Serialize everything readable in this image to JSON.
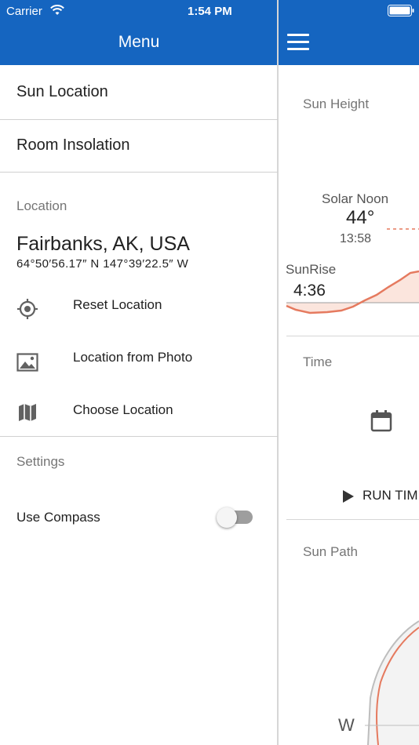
{
  "status_bar": {
    "carrier": "Carrier",
    "time": "1:54 PM"
  },
  "drawer": {
    "title": "Menu",
    "items": [
      {
        "label": "Sun Location"
      },
      {
        "label": "Room Insolation"
      }
    ],
    "location_section": {
      "header": "Location",
      "place": "Fairbanks, AK, USA",
      "coordinates": "64°50′56.17″ N 147°39′22.5″ W",
      "actions": [
        {
          "label": "Reset Location",
          "icon": "target-icon"
        },
        {
          "label": "Location from Photo",
          "icon": "image-icon"
        },
        {
          "label": "Choose Location",
          "icon": "map-icon"
        }
      ]
    },
    "settings_section": {
      "header": "Settings",
      "use_compass_label": "Use Compass",
      "use_compass_enabled": false
    }
  },
  "main": {
    "sun_height": {
      "title": "Sun Height",
      "solar_noon_label": "Solar Noon",
      "solar_noon_angle": "44°",
      "solar_noon_time": "13:58",
      "sunrise_label": "SunRise",
      "sunrise_time": "4:36"
    },
    "time": {
      "title": "Time",
      "run_label": "RUN TIM"
    },
    "sun_path": {
      "title": "Sun Path",
      "west_label": "W"
    }
  },
  "colors": {
    "header": "#1565c0",
    "curve": "#e57a5f",
    "toggle_off": "#9e9e9e"
  }
}
